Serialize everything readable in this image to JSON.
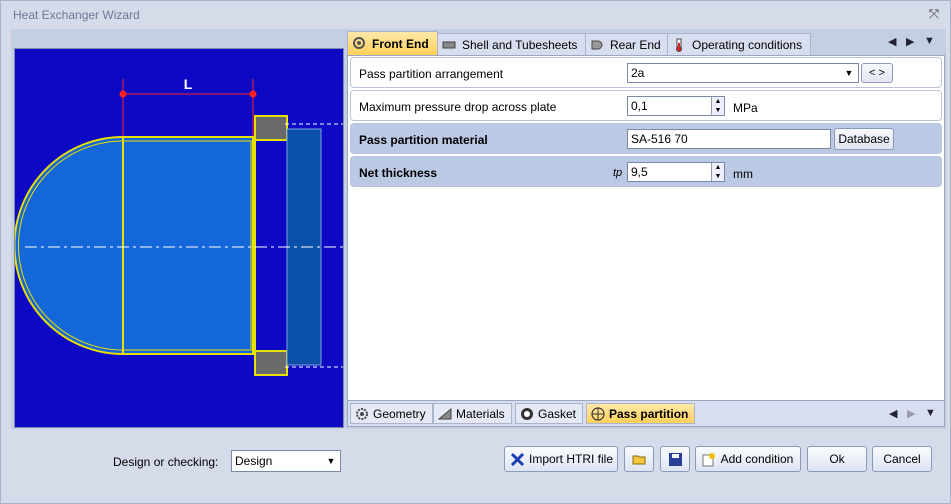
{
  "window": {
    "title": "Heat Exchanger Wizard",
    "close_glyph": "⤧"
  },
  "drawing": {
    "dimension_label": "L"
  },
  "top_tabs": [
    {
      "label": "Front End",
      "icon": "front-end-icon",
      "active": true
    },
    {
      "label": "Shell and Tubesheets",
      "icon": "shell-icon",
      "active": false
    },
    {
      "label": "Rear End",
      "icon": "rear-end-icon",
      "active": false
    },
    {
      "label": "Operating conditions",
      "icon": "thermometer-icon",
      "active": false
    }
  ],
  "form": {
    "pass_partition_arrangement": {
      "label": "Pass partition arrangement",
      "value": "2a",
      "nav": "< >"
    },
    "max_pressure_drop": {
      "label": "Maximum pressure drop across plate",
      "value": "0,1",
      "unit": "MPa"
    },
    "pass_partition_material": {
      "label": "Pass partition material",
      "value": "SA-516 70",
      "button": "Database"
    },
    "net_thickness": {
      "label": "Net thickness",
      "symbol": "tp",
      "value": "9,5",
      "unit": "mm"
    }
  },
  "bottom_tabs": [
    {
      "label": "Geometry",
      "icon": "gear-icon"
    },
    {
      "label": "Materials",
      "icon": "materials-icon"
    },
    {
      "label": "Gasket",
      "icon": "gasket-icon"
    },
    {
      "label": "Pass partition",
      "icon": "pass-partition-icon",
      "active": true
    }
  ],
  "footer": {
    "design_label": "Design or checking:",
    "design_value": "Design",
    "import_button": "Import HTRI file",
    "add_condition_button": "Add condition",
    "ok_button": "Ok",
    "cancel_button": "Cancel"
  }
}
